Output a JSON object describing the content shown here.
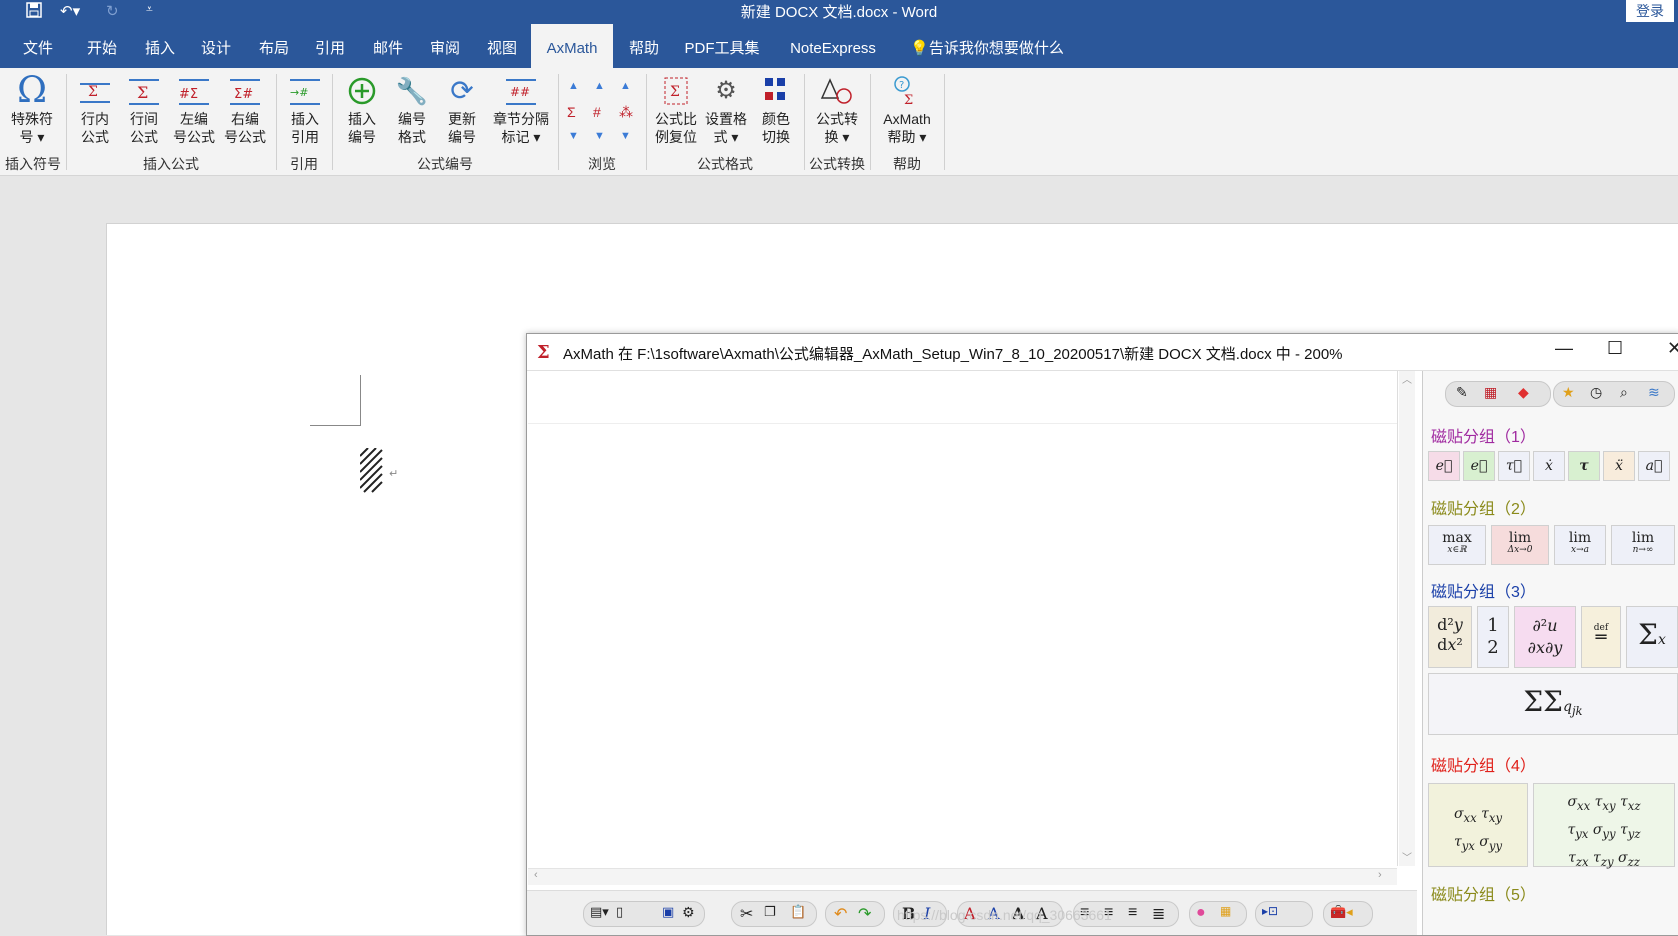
{
  "titlebar": {
    "title": "新建 DOCX 文档.docx  -  Word",
    "login": "登录"
  },
  "tabs": [
    "文件",
    "开始",
    "插入",
    "设计",
    "布局",
    "引用",
    "邮件",
    "审阅",
    "视图",
    "AxMath",
    "帮助",
    "PDF工具集",
    "NoteExpress"
  ],
  "active_tab": "AxMath",
  "tell_me": "告诉我你想要做什么",
  "ribbon": {
    "special_char": {
      "l1": "特殊符",
      "l2": "号 ▾"
    },
    "inline_formula": {
      "l1": "行内",
      "l2": "公式"
    },
    "display_formula": {
      "l1": "行间",
      "l2": "公式"
    },
    "left_numbered": {
      "l1": "左编",
      "l2": "号公式"
    },
    "right_numbered": {
      "l1": "右编",
      "l2": "号公式"
    },
    "insert_ref": {
      "l1": "插入",
      "l2": "引用"
    },
    "insert_number": {
      "l1": "插入",
      "l2": "编号"
    },
    "number_format": {
      "l1": "编号",
      "l2": "格式"
    },
    "update_number": {
      "l1": "更新",
      "l2": "编号"
    },
    "chapter_sep": {
      "l1": "章节分隔",
      "l2": "标记 ▾"
    },
    "scale_reset": {
      "l1": "公式比",
      "l2": "例复位"
    },
    "set_format": {
      "l1": "设置格",
      "l2": "式 ▾"
    },
    "color_switch": {
      "l1": "颜色",
      "l2": "切换"
    },
    "convert": {
      "l1": "公式转",
      "l2": "换 ▾"
    },
    "axhelp": {
      "l1": "AxMath",
      "l2": "帮助 ▾"
    },
    "groups": {
      "insert_symbol": "插入符号",
      "insert_formula": "插入公式",
      "reference": "引用",
      "formula_number": "公式编号",
      "browse": "浏览",
      "formula_format": "公式格式",
      "formula_convert": "公式转换",
      "help": "帮助"
    }
  },
  "axmath": {
    "title": "AxMath 在 F:\\1software\\Axmath\\公式编辑器_AxMath_Setup_Win7_8_10_20200517\\新建 DOCX 文档.docx 中 - 200%",
    "groups": [
      "磁贴分组（1）",
      "磁贴分组（2）",
      "磁贴分组（3）",
      "磁贴分组（4）",
      "磁贴分组（5）"
    ],
    "group_colors": [
      "#a02aa0",
      "#8a8a1a",
      "#1a3fa8",
      "#e0201a",
      "#8a8a1a"
    ],
    "watermark": "https://blog.csdn.net/qq_30663661"
  }
}
